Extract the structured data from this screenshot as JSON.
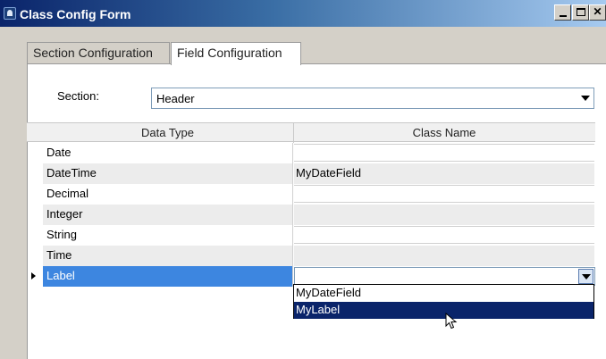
{
  "window": {
    "title": "Class Config Form"
  },
  "tabs": [
    {
      "label": "Section Configuration",
      "active": false
    },
    {
      "label": "Field Configuration",
      "active": true
    }
  ],
  "section": {
    "label": "Section:",
    "value": "Header"
  },
  "grid": {
    "columns": [
      "Data Type",
      "Class Name"
    ],
    "rows": [
      {
        "data_type": "Date",
        "class_name": ""
      },
      {
        "data_type": "DateTime",
        "class_name": "MyDateField"
      },
      {
        "data_type": "Decimal",
        "class_name": ""
      },
      {
        "data_type": "Integer",
        "class_name": ""
      },
      {
        "data_type": "String",
        "class_name": ""
      },
      {
        "data_type": "Time",
        "class_name": ""
      },
      {
        "data_type": "Label",
        "class_name": "",
        "selected": true
      }
    ]
  },
  "dropdown": {
    "options": [
      "MyDateField",
      "MyLabel"
    ],
    "highlighted": "MyLabel"
  },
  "colors": {
    "title_start": "#0a246a",
    "selected_row": "#3d86e0",
    "dropdown_highlight": "#0a246a"
  }
}
